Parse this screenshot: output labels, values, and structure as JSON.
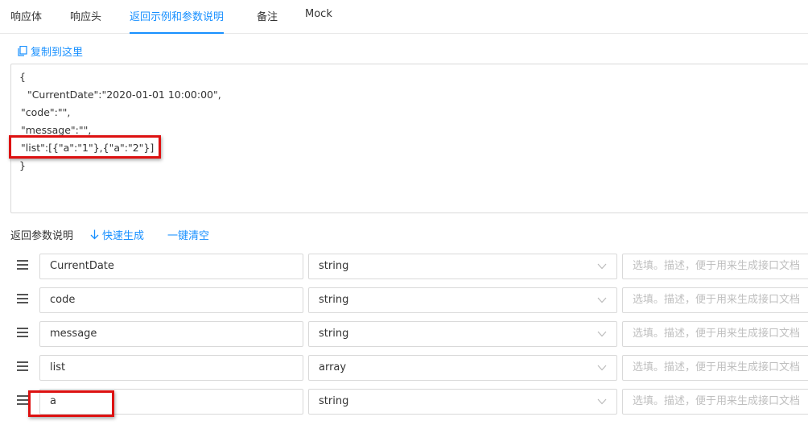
{
  "tabs": [
    {
      "label": "响应体",
      "active": false
    },
    {
      "label": "响应头",
      "active": false
    },
    {
      "label": "返回示例和参数说明",
      "active": true
    },
    {
      "label": "备注",
      "active": false
    },
    {
      "label": "Mock",
      "active": false
    }
  ],
  "copy_link": {
    "label": "复制到这里",
    "icon": "copy-icon"
  },
  "example_json": {
    "lines": [
      "{",
      "  \"CurrentDate\":\"2020-01-01 10:00:00\",",
      "\"code\":\"\",",
      "\"message\":\"\",",
      "\"list\":[{\"a\":\"1\"},{\"a\":\"2\"}]",
      "}"
    ]
  },
  "params": {
    "title": "返回参数说明",
    "quick_generate": {
      "label": "快速生成",
      "icon": "arrow-down-icon"
    },
    "clear_all": "一键清空",
    "rows": [
      {
        "name": "CurrentDate",
        "type": "string",
        "desc_placeholder": "选填。描述，便于用来生成接口文档"
      },
      {
        "name": "code",
        "type": "string",
        "desc_placeholder": "选填。描述，便于用来生成接口文档"
      },
      {
        "name": "message",
        "type": "string",
        "desc_placeholder": "选填。描述，便于用来生成接口文档"
      },
      {
        "name": "list",
        "type": "array",
        "desc_placeholder": "选填。描述，便于用来生成接口文档"
      },
      {
        "name": "a",
        "type": "string",
        "desc_placeholder": "选填。描述，便于用来生成接口文档"
      }
    ]
  },
  "colors": {
    "accent": "#1890ff",
    "highlight": "#dd1111"
  }
}
